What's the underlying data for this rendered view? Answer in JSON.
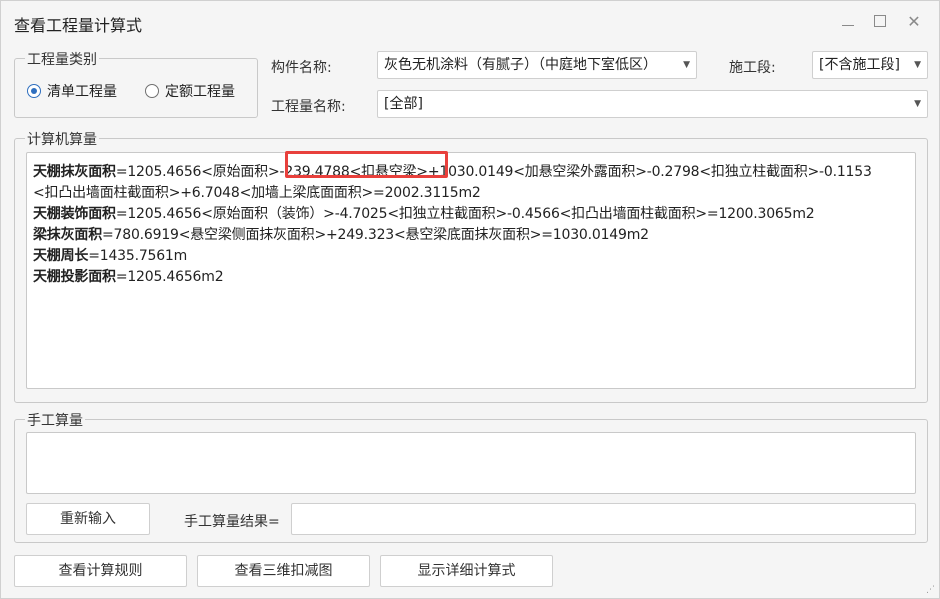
{
  "window": {
    "title": "查看工程量计算式"
  },
  "quantity_type": {
    "legend": "工程量类别",
    "options": [
      "清单工程量",
      "定额工程量"
    ],
    "selected": "清单工程量"
  },
  "filters": {
    "component_label": "构件名称:",
    "component_value": "灰色无机涂料（有腻子）（中庭地下室低区）",
    "phase_label": "施工段:",
    "phase_value": "[不含施工段]",
    "quantity_name_label": "工程量名称:",
    "quantity_name_value": "[全部]"
  },
  "computer_calc": {
    "legend": "计算机算量",
    "lines": [
      {
        "head": "天棚抹灰面积",
        "body": "=1205.4656<原始面积>-239.4788<扣悬空梁>+1030.0149<加悬空梁外露面积>-0.2798<扣独立柱截面积>-0.1153"
      },
      {
        "head": "",
        "body": "<扣凸出墙面柱截面积>+6.7048<加墙上梁底面面积>=2002.3115m2"
      },
      {
        "head": "天棚装饰面积",
        "body": "=1205.4656<原始面积（装饰）>-4.7025<扣独立柱截面积>-0.4566<扣凸出墙面柱截面积>=1200.3065m2"
      },
      {
        "head": "梁抹灰面积",
        "body": "=780.6919<悬空梁侧面抹灰面积>+249.323<悬空梁底面抹灰面积>=1030.0149m2"
      },
      {
        "head": "天棚周长",
        "body": "=1435.7561m"
      },
      {
        "head": "天棚投影面积",
        "body": "=1205.4656m2"
      }
    ],
    "highlight_color": "#e8403c"
  },
  "manual_calc": {
    "legend": "手工算量",
    "reenter_button": "重新输入",
    "result_label": "手工算量结果="
  },
  "footer": {
    "view_rules_button": "查看计算规则",
    "view_3d_button": "查看三维扣减图",
    "show_detail_button": "显示详细计算式"
  }
}
